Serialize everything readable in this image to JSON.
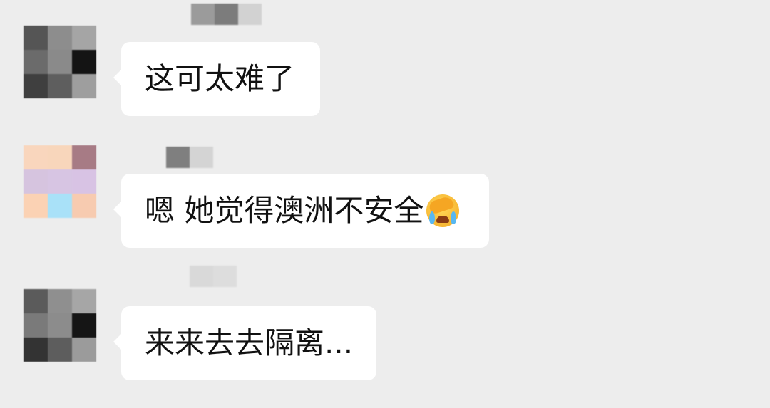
{
  "messages": [
    {
      "text": "这可太难了",
      "avatar_colors": [
        "#555555",
        "#8d8d8d",
        "#a5a5a5",
        "#6b6b6b",
        "#8a8a8a",
        "#141414",
        "#3f3f3f",
        "#5e5e5e",
        "#9e9e9e"
      ],
      "sender_colors": [
        "#9b9b9b",
        "#7c7c7c",
        "#d2d2d2"
      ]
    },
    {
      "text": "嗯 她觉得澳洲不安全",
      "emoji": "face-palm-crying-emoji",
      "avatar_colors": [
        "#f9d6bd",
        "#f8d6bb",
        "#a77b85",
        "#d6c4df",
        "#d7c5e3",
        "#d8c3e4",
        "#fbd2b4",
        "#a9e1f8",
        "#f7cbb0"
      ],
      "sender_colors": [
        "#7f7f7f",
        "#d4d4d4"
      ]
    },
    {
      "text": "来来去去隔离...",
      "avatar_colors": [
        "#5b5b5b",
        "#8f8f8f",
        "#a6a6a6",
        "#7a7a7a",
        "#8c8c8c",
        "#151515",
        "#333333",
        "#5d5d5d",
        "#9b9b9b"
      ],
      "sender_colors": [
        "#d9d9d9",
        "#dddddd"
      ]
    }
  ]
}
